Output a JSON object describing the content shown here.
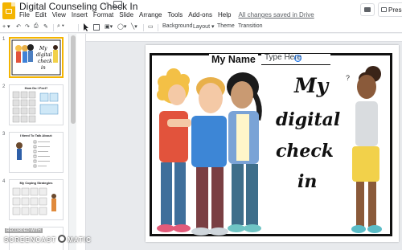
{
  "window": {
    "title": "Digital Counseling Check In",
    "save_status": "All changes saved in Drive",
    "present_label": "Prese"
  },
  "menu": [
    "File",
    "Edit",
    "View",
    "Insert",
    "Format",
    "Slide",
    "Arrange",
    "Tools",
    "Add-ons",
    "Help"
  ],
  "toolbar": {
    "background": "Background",
    "layout": "Layout",
    "theme": "Theme",
    "transition": "Transition"
  },
  "filmstrip": {
    "slides": [
      {
        "number": "1",
        "title": "",
        "selected": true
      },
      {
        "number": "2",
        "title": "How Do I Feel?",
        "selected": false
      },
      {
        "number": "3",
        "title": "I Need To Talk About:",
        "selected": false
      },
      {
        "number": "4",
        "title": "My Coping Strategies",
        "selected": false
      }
    ]
  },
  "slide": {
    "name_label": "My Name",
    "name_input_value": "Type Here",
    "title_words": [
      "My",
      "digital",
      "check",
      "in"
    ],
    "question_mark": "?"
  },
  "watermark": {
    "top": "RECORDED WITH",
    "brand_left": "SCREENCAST",
    "brand_right": "MATIC"
  },
  "colors": {
    "logo": "#f4b400",
    "selected_border": "#f4b400",
    "accent": "#1a73e8"
  }
}
